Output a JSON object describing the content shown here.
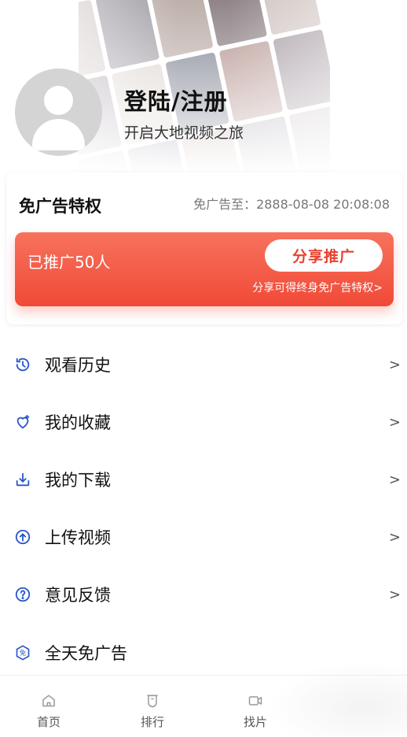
{
  "header": {
    "login_title": "登陆/注册",
    "login_subtitle": "开启大地视频之旅"
  },
  "ad_card": {
    "title": "免广告特权",
    "expiry": "免广告至：2888-08-08 20:08:08",
    "promoted_count": "已推广50人",
    "share_button": "分享推广",
    "share_note": "分享可得终身免广告特权>"
  },
  "menu": {
    "items": [
      {
        "label": "观看历史",
        "icon": "history-icon"
      },
      {
        "label": "我的收藏",
        "icon": "favorite-heart-icon"
      },
      {
        "label": "我的下载",
        "icon": "download-icon"
      },
      {
        "label": "上传视频",
        "icon": "upload-icon"
      },
      {
        "label": "意见反馈",
        "icon": "feedback-question-icon"
      },
      {
        "label": "全天免广告",
        "icon": "ad-free-badge-icon"
      }
    ],
    "chevron": ">"
  },
  "bottom_nav": {
    "items": [
      {
        "label": "首页",
        "icon": "home-icon"
      },
      {
        "label": "排行",
        "icon": "ranking-icon"
      },
      {
        "label": "找片",
        "icon": "video-camera-icon"
      }
    ]
  },
  "colors": {
    "accent": "#f04a37",
    "icon_blue": "#2b57c9"
  }
}
